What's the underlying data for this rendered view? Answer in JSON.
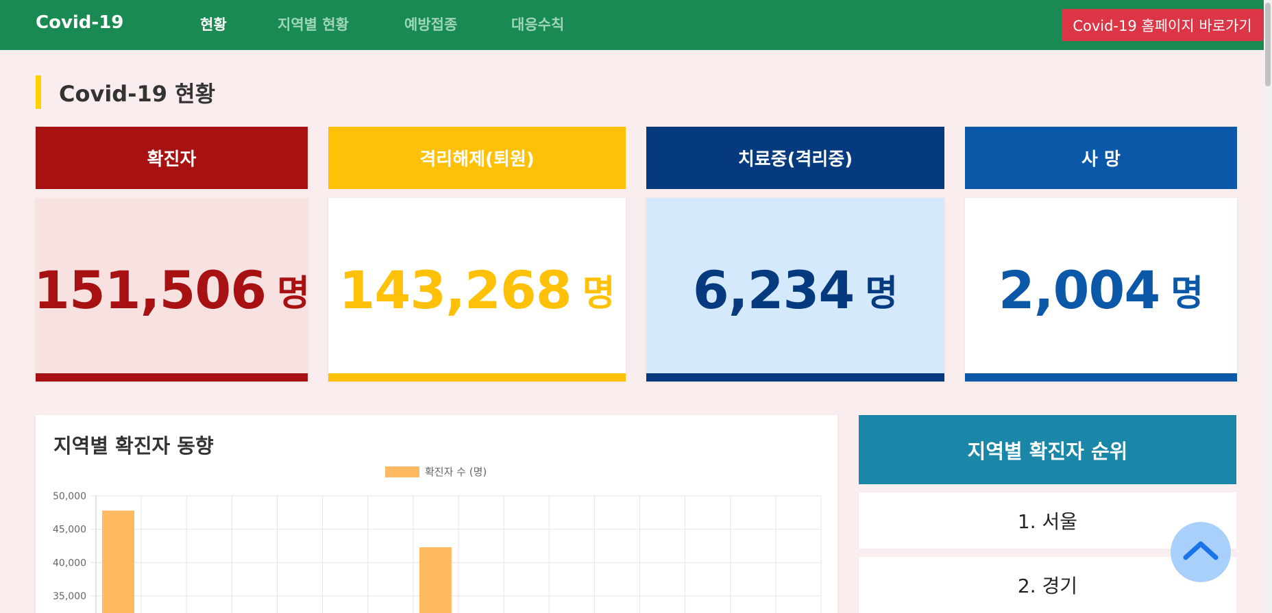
{
  "nav": {
    "brand": "Covid-19",
    "links": [
      "현황",
      "지역별 현황",
      "예방접종",
      "대응수칙"
    ],
    "home_button": "Covid-19 홈페이지 바로가기"
  },
  "section": {
    "title": "Covid-19 현황"
  },
  "cards": [
    {
      "title": "확진자",
      "value": "151,506",
      "unit": "명",
      "color": "#a81111",
      "bg": "#f7e1e1"
    },
    {
      "title": "격리해제(퇴원)",
      "value": "143,268",
      "unit": "명",
      "color": "#ffc107",
      "bg": "#ffffff"
    },
    {
      "title": "치료중(격리중)",
      "value": "6,234",
      "unit": "명",
      "color": "#053b7e",
      "bg": "#d5e9fd"
    },
    {
      "title": "사 망",
      "value": "2,004",
      "unit": "명",
      "color": "#0b58a8",
      "bg": "#ffffff"
    }
  ],
  "chart_panel": {
    "title": "지역별 확진자 동향"
  },
  "chart_data": {
    "type": "bar",
    "legend": "확진자 수 (명)",
    "bar_color": "#ffb961",
    "y_ticks": [
      "50,000",
      "45,000",
      "40,000",
      "35,000"
    ],
    "ylim": [
      0,
      50000
    ],
    "values": [
      47800,
      null,
      null,
      null,
      null,
      null,
      null,
      42300,
      null,
      null,
      null,
      null,
      null,
      null,
      null,
      null
    ]
  },
  "ranking": {
    "title": "지역별 확진자 순위",
    "items": [
      "1. 서울",
      "2. 경기"
    ]
  },
  "icons": {
    "to_top": "chevron-up-icon"
  }
}
